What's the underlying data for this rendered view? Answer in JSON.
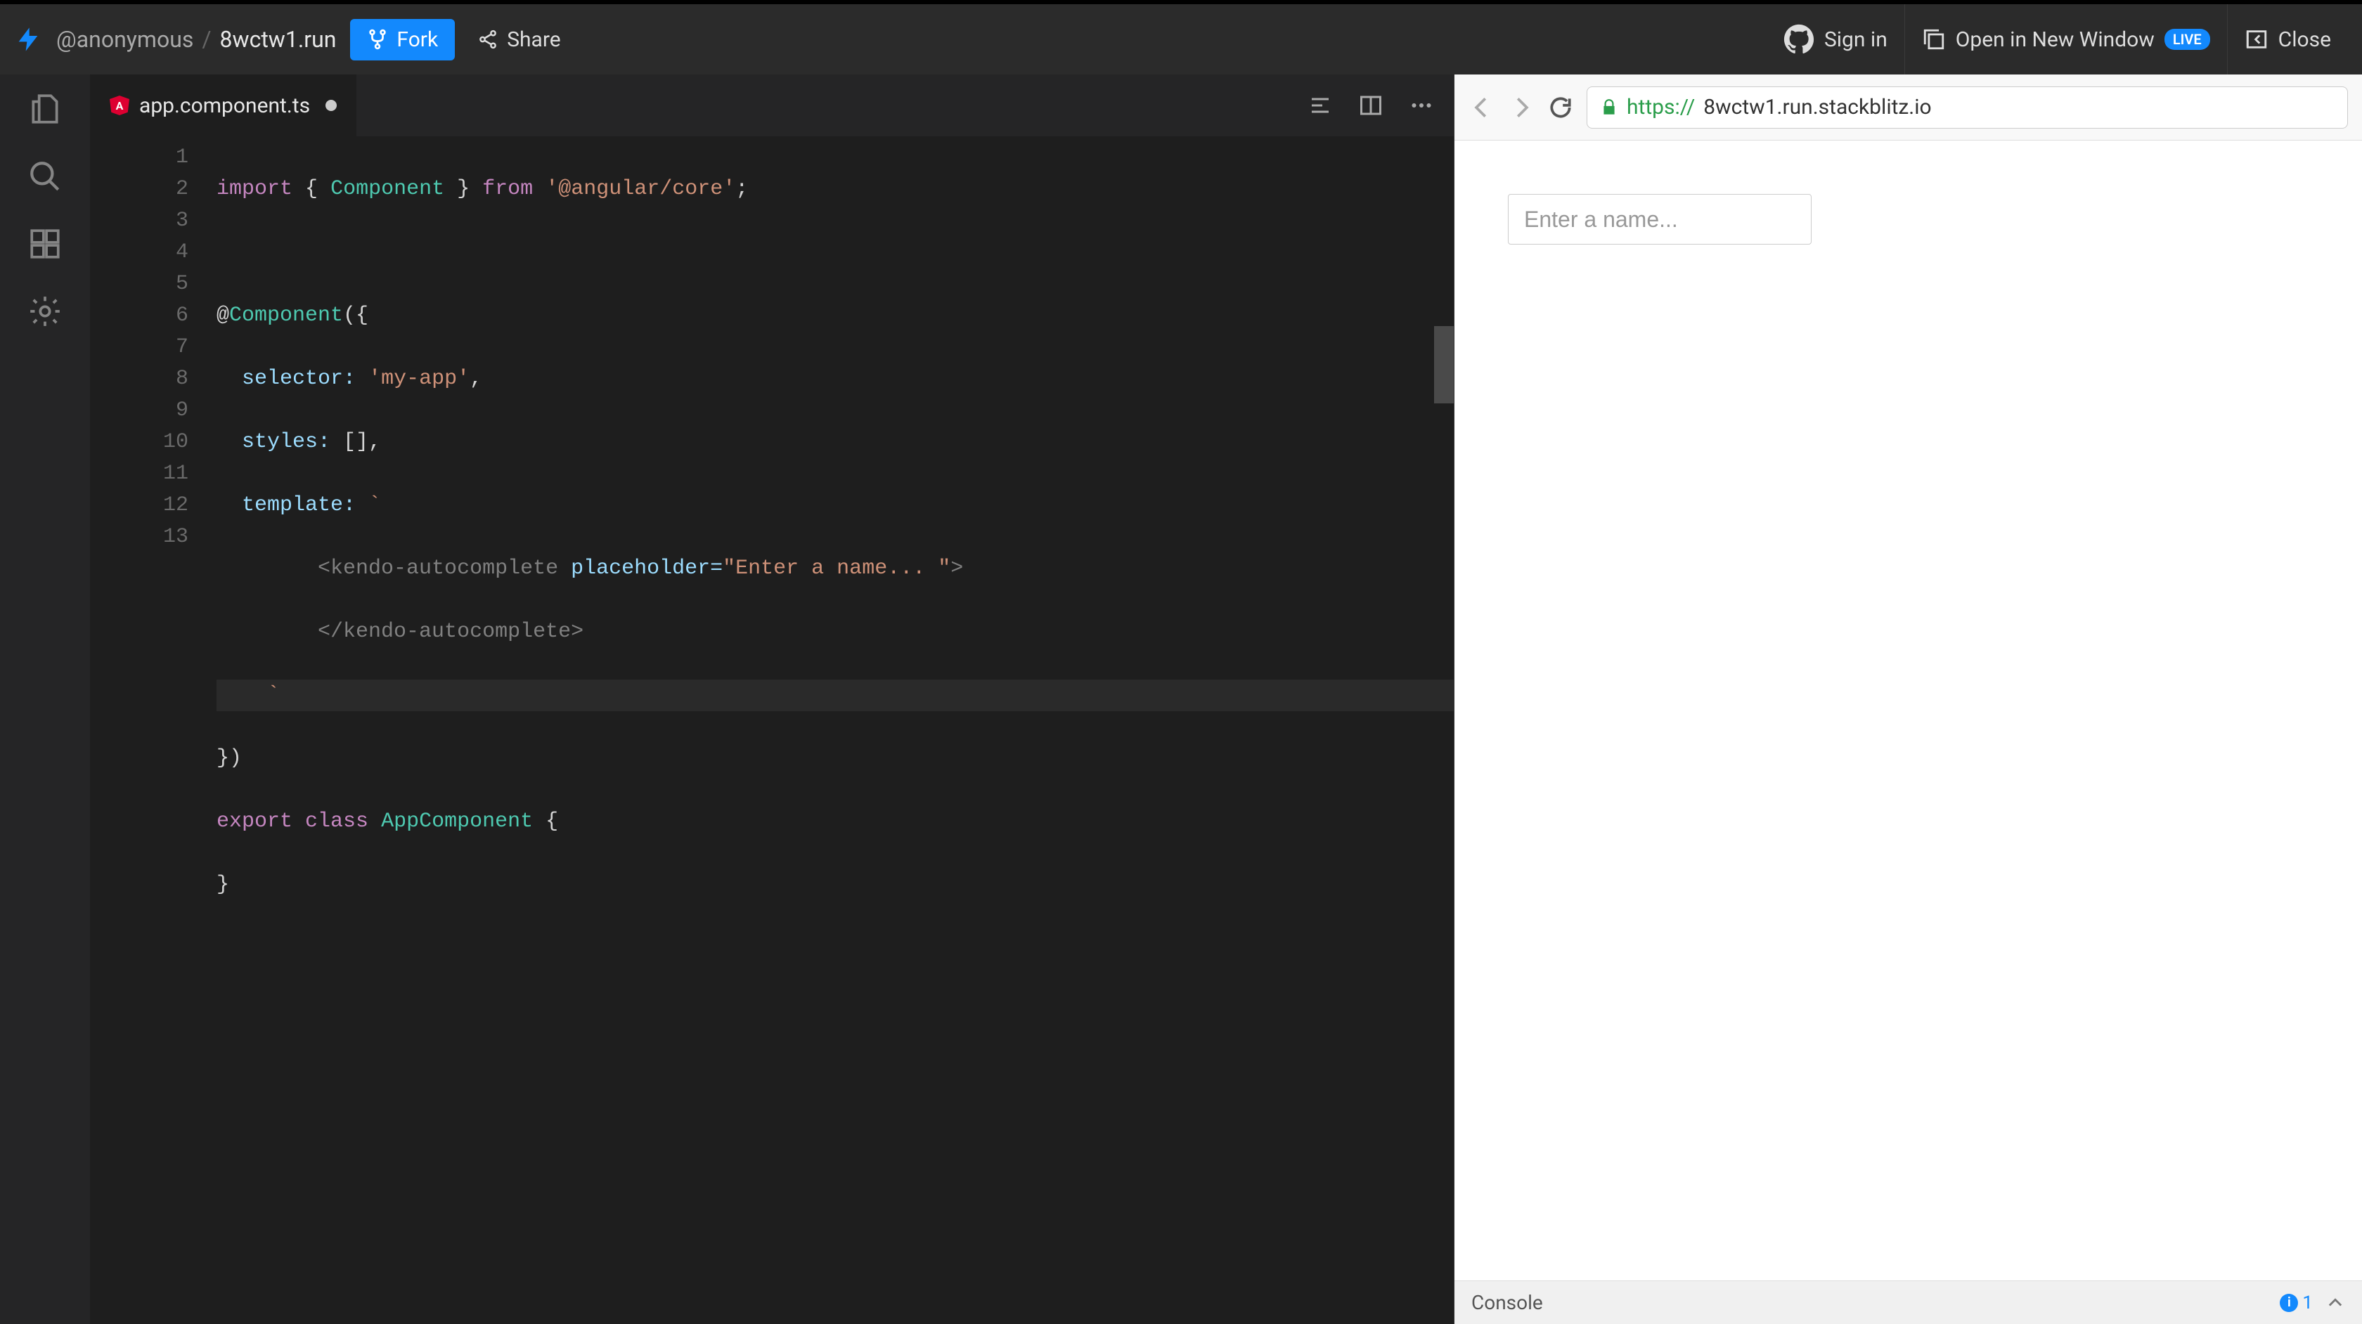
{
  "header": {
    "breadcrumb_user": "@anonymous",
    "breadcrumb_sep": "/",
    "breadcrumb_project": "8wctw1.run",
    "fork_label": "Fork",
    "share_label": "Share",
    "signin_label": "Sign in",
    "open_new_window_label": "Open in New Window",
    "live_badge": "LIVE",
    "close_label": "Close"
  },
  "tabs": {
    "active_file": "app.component.ts"
  },
  "editor": {
    "line_numbers": [
      "1",
      "2",
      "3",
      "4",
      "5",
      "6",
      "7",
      "8",
      "9",
      "10",
      "11",
      "12",
      "13"
    ],
    "code": {
      "l1": {
        "import": "import",
        "lb": "{",
        "Component": "Component",
        "rb": "}",
        "from": "from",
        "pkg": "'@angular/core'",
        "semi": ";"
      },
      "l3": {
        "dec": "@",
        "Component": "Component",
        "open": "({"
      },
      "l4": {
        "key": "selector:",
        "val": "'my-app'",
        "comma": ","
      },
      "l5": {
        "key": "styles:",
        "val": "[]",
        "comma": ","
      },
      "l6": {
        "key": "template:",
        "tick": "`"
      },
      "l7": {
        "open": "<kendo-autocomplete",
        "attr": "placeholder=",
        "str": "\"Enter a name... \"",
        "close": ">"
      },
      "l8": {
        "close": "</kendo-autocomplete>"
      },
      "l9": {
        "tick": "`"
      },
      "l10": {
        "close": "})"
      },
      "l11": {
        "export": "export",
        "class": "class",
        "name": "AppComponent",
        "brace": "{"
      },
      "l12": {
        "brace": "}"
      }
    }
  },
  "preview": {
    "url_proto": "https://",
    "url_rest": "8wctw1.run.stackblitz.io",
    "input_placeholder": "Enter a name..."
  },
  "console": {
    "label": "Console",
    "info_count": "1",
    "info_i": "i"
  }
}
